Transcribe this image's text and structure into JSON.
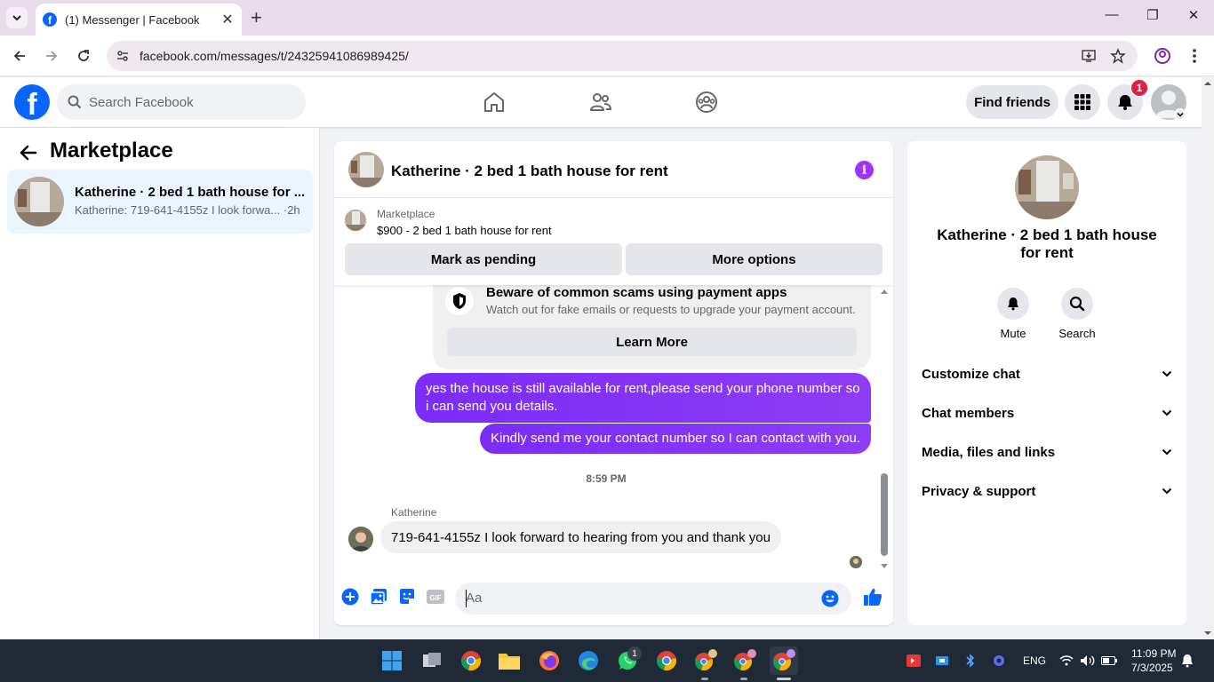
{
  "browser": {
    "tab_title": "(1) Messenger | Facebook",
    "tab_favicon": "f",
    "url": "facebook.com/messages/t/24325941086989425/"
  },
  "fb_header": {
    "logo": "f",
    "search_placeholder": "Search Facebook",
    "find_friends": "Find friends",
    "notification_count": "1"
  },
  "left_panel": {
    "title": "Marketplace",
    "conversations": [
      {
        "name": "Katherine · 2 bed 1 bath house for ...",
        "preview": "Katherine: 719-641-4155z I look forwa... ·2h"
      }
    ]
  },
  "chat": {
    "title": "Katherine · 2 bed 1 bath house for rent",
    "info_icon": "i",
    "marketplace_label": "Marketplace",
    "listing": "$900 - 2 bed 1 bath house for rent",
    "mark_pending": "Mark as pending",
    "more_options": "More options",
    "scam_title": "Beware of common scams using payment apps",
    "scam_desc": "Watch out for fake emails or requests to upgrade your payment account.",
    "learn_more": "Learn More",
    "outgoing": [
      "yes the house is still available for rent,please send your phone number so i can send you details.",
      "Kindly send me your contact number so I can contact with you."
    ],
    "timestamp": "8:59 PM",
    "sender": "Katherine",
    "incoming": "719-641-4155z I look forward to hearing from you and thank you",
    "composer_placeholder": "Aa"
  },
  "right_panel": {
    "name": "Katherine · 2 bed 1 bath house for rent",
    "mute": "Mute",
    "search": "Search",
    "sections": [
      "Customize chat",
      "Chat members",
      "Media, files and links",
      "Privacy & support"
    ]
  },
  "taskbar": {
    "language": "ENG",
    "time": "11:09 PM",
    "date": "7/3/2025",
    "whatsapp_badge": "1"
  },
  "colors": {
    "fb_blue": "#0866ff",
    "messenger_purple": "#8a3ffc",
    "notification_red": "#e41e3f"
  }
}
